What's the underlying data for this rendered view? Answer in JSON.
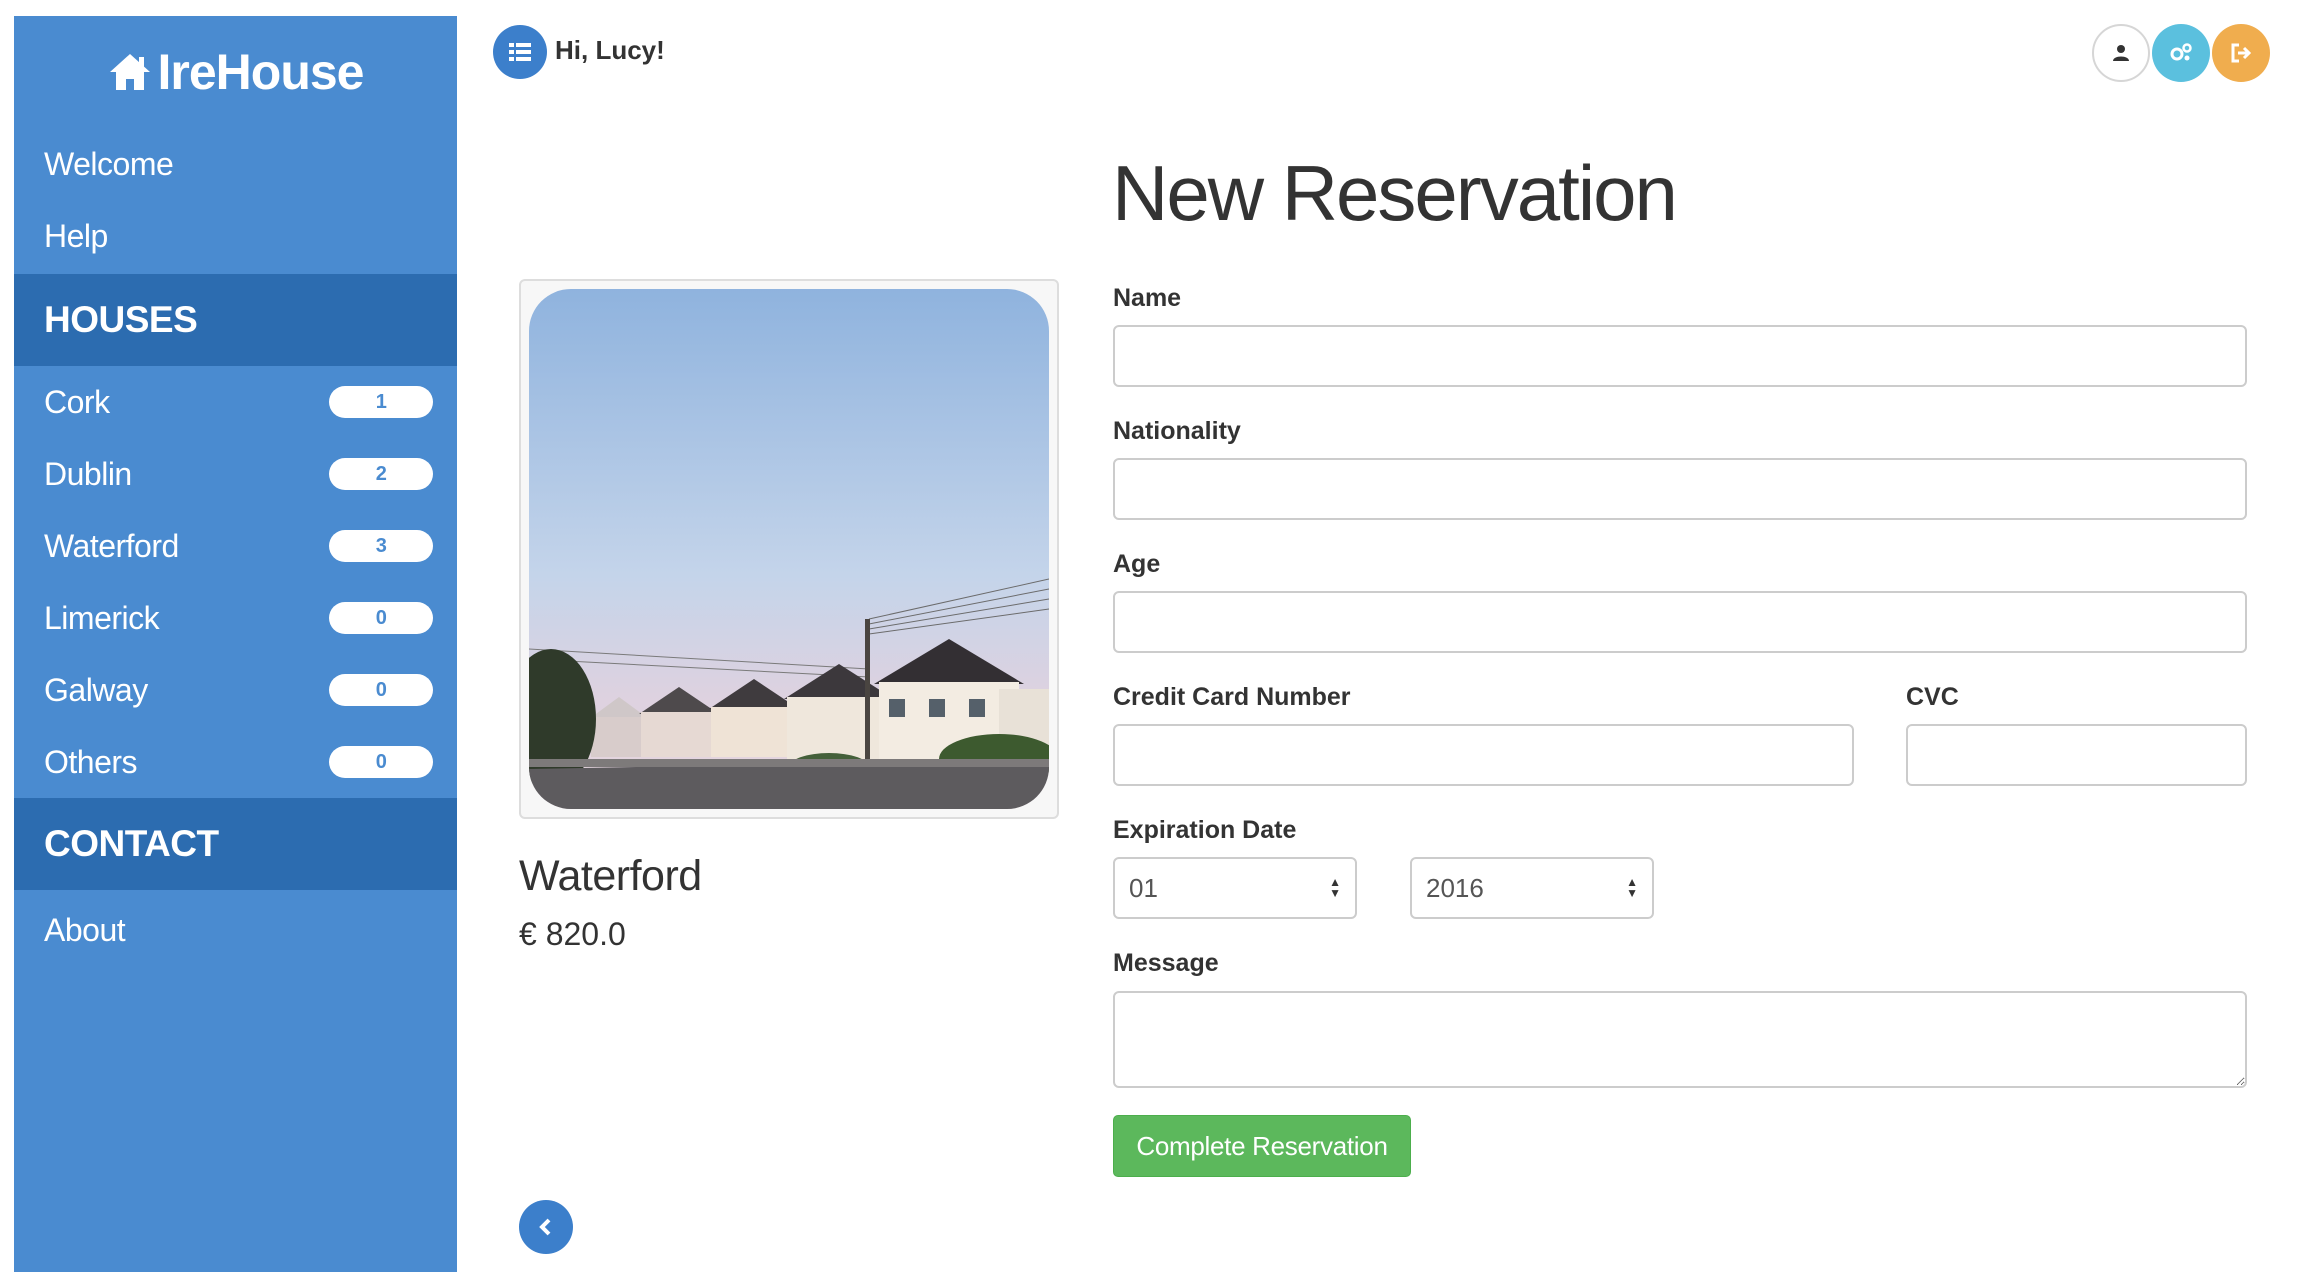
{
  "brand": {
    "name": "IreHouse",
    "icon": "home-icon"
  },
  "sidebar": {
    "links": [
      {
        "label": "Welcome"
      },
      {
        "label": "Help"
      }
    ],
    "houses_heading": "HOUSES",
    "houses": [
      {
        "label": "Cork",
        "count": "1"
      },
      {
        "label": "Dublin",
        "count": "2"
      },
      {
        "label": "Waterford",
        "count": "3"
      },
      {
        "label": "Limerick",
        "count": "0"
      },
      {
        "label": "Galway",
        "count": "0"
      },
      {
        "label": "Others",
        "count": "0"
      }
    ],
    "contact_heading": "CONTACT",
    "contact_links": [
      {
        "label": "About"
      }
    ]
  },
  "header": {
    "greeting": "Hi, Lucy!",
    "menu_icon": "list-icon",
    "user_icon": "user-icon",
    "settings_icon": "settings-icon",
    "logout_icon": "logout-icon"
  },
  "property": {
    "name": "Waterford",
    "price": "€ 820.0"
  },
  "form": {
    "title": "New Reservation",
    "name_label": "Name",
    "name_value": "",
    "nationality_label": "Nationality",
    "nationality_value": "",
    "age_label": "Age",
    "age_value": "",
    "card_label": "Credit Card Number",
    "card_value": "",
    "cvc_label": "CVC",
    "cvc_value": "",
    "expiration_label": "Expiration Date",
    "expiration_month": "01",
    "expiration_year": "2016",
    "message_label": "Message",
    "message_value": "",
    "submit_label": "Complete Reservation"
  },
  "colors": {
    "sidebar": "#4a8bd0",
    "sidebar_section": "#2c6cb0",
    "primary": "#3c7fcb",
    "settings": "#5bc0de",
    "logout": "#f0ad4e",
    "submit": "#5cb85c"
  }
}
